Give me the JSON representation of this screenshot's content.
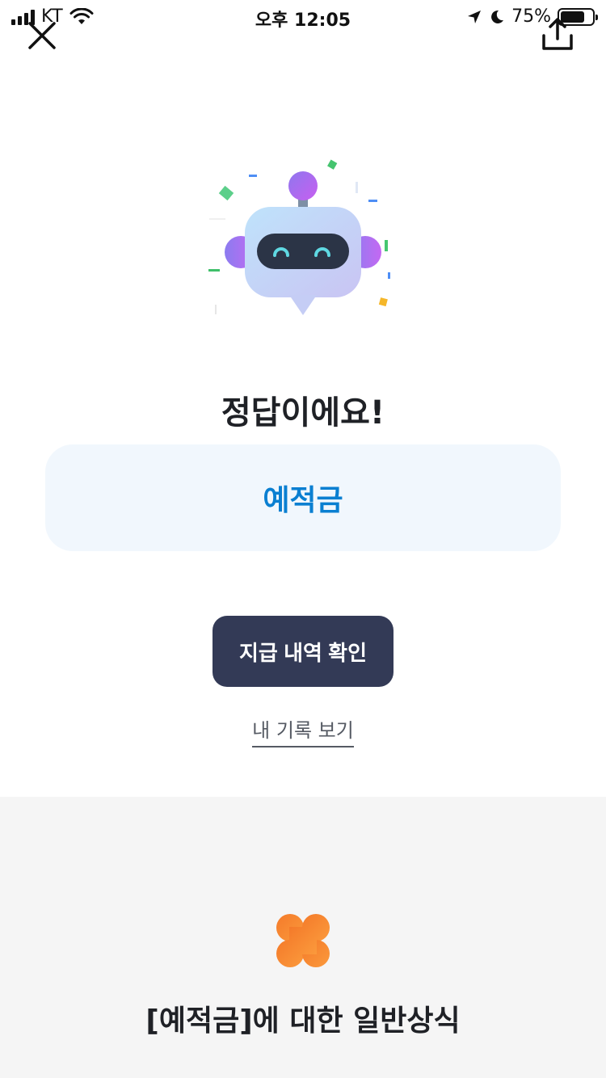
{
  "status_bar": {
    "carrier": "KT",
    "time": "오후 12:05",
    "battery_percent": "75%",
    "battery_level": 0.75
  },
  "nav": {
    "close_icon": "close-icon",
    "share_icon": "share-upload-icon"
  },
  "result": {
    "title": "정답이에요!",
    "answer": "예적금"
  },
  "actions": {
    "primary_label": "지급 내역 확인",
    "secondary_label": "내 기록 보기"
  },
  "info": {
    "icon": "clover-icon",
    "title": "[예적금]에 대한 일반상식"
  },
  "colors": {
    "answer_text": "#0a7fd1",
    "answer_card_bg": "#f1f7fd",
    "primary_button": "#333a56",
    "clover": "#f58a2e",
    "section_bg": "#f5f5f5"
  }
}
